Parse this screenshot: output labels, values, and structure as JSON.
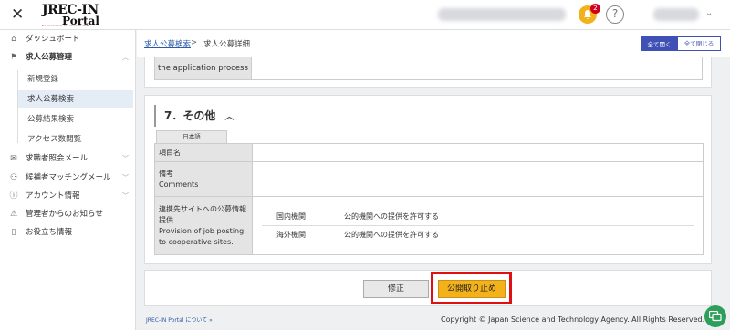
{
  "header": {
    "logo_main": "JREC-IN",
    "logo_sub": "Portal",
    "logo_tagline": "for researchers and research staff",
    "notification_count": "2",
    "help_symbol": "?"
  },
  "sidebar": {
    "items": [
      {
        "label": "ダッシュボード",
        "icon": "home-icon"
      },
      {
        "label": "求人公募管理",
        "icon": "flag-icon"
      },
      {
        "label": "求職者照会メール",
        "icon": "mail-icon"
      },
      {
        "label": "候補者マッチングメール",
        "icon": "people-icon"
      },
      {
        "label": "アカウント情報",
        "icon": "info-icon"
      },
      {
        "label": "管理者からのお知らせ",
        "icon": "warning-icon"
      },
      {
        "label": "お役立ち情報",
        "icon": "book-icon"
      }
    ],
    "sub_items": [
      "新規登録",
      "求人公募検索",
      "公募結果検索",
      "アクセス数閲覧"
    ]
  },
  "breadcrumb": {
    "link": "求人公募検索",
    "separator": ">",
    "current": "求人公募詳細"
  },
  "toolbar": {
    "expand_all": "全て開く",
    "collapse_all": "全て閉じる"
  },
  "prev_section": {
    "label": "the application process"
  },
  "section": {
    "title": "7．その他",
    "lang_tab": "日本語",
    "rows": [
      {
        "label": "項目名",
        "value": ""
      },
      {
        "label": "備考\nComments",
        "value": ""
      },
      {
        "label": "連携先サイトへの公募情報提供\nProvision of job posting to cooperative sites."
      }
    ],
    "provision": [
      {
        "key": "国内機関",
        "value": "公的機関への提供を許可する"
      },
      {
        "key": "海外機関",
        "value": "公的機関への提供を許可する"
      }
    ]
  },
  "actions": {
    "edit": "修正",
    "stop_publish": "公開取り止め"
  },
  "footer": {
    "about_link": "JREC-IN Portal について »",
    "copyright": "Copyright © Japan Science and Technology Agency. All Rights Reserved."
  },
  "colors": {
    "accent": "#3f51b5",
    "warning_button": "#f3b21a",
    "highlight": "#e01010",
    "link": "#2b5aa6"
  }
}
